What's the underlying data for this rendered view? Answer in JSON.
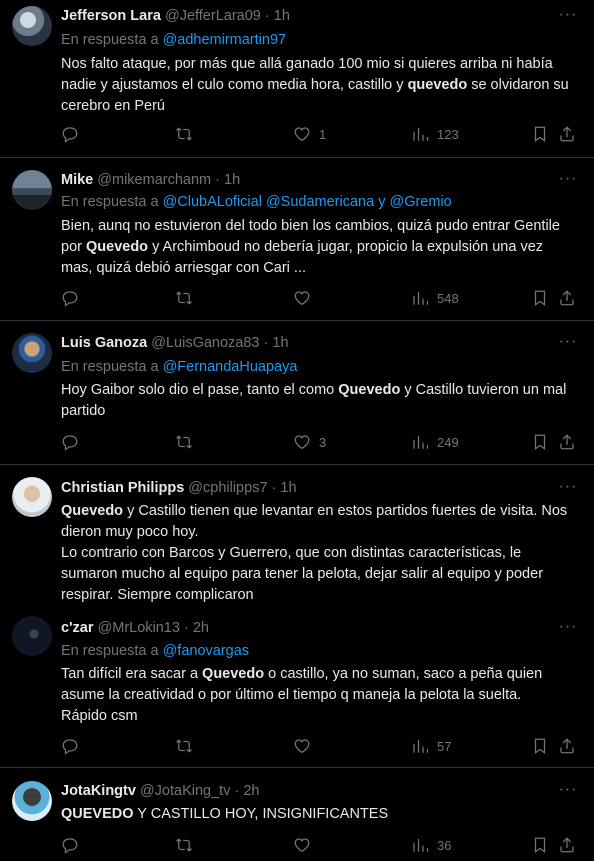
{
  "tweets": [
    {
      "name": "Jefferson Lara",
      "handle": "@JefferLara09",
      "sep": "·",
      "time": "1h",
      "reply_prefix": "En respuesta a",
      "reply_to": "@adhemirmartin97",
      "body_1": "Nos falto ataque, por más que allá ganado 100 mio si quieres arriba ni había nadie y ajustamos el culo como media hora,  castillo y ",
      "body_2": "quevedo",
      "body_3": " se olvidaron su cerebro en Perú",
      "likes": "1",
      "views": "123"
    },
    {
      "name": "Mike",
      "handle": "@mikemarchanm",
      "sep": "·",
      "time": "1h",
      "reply_prefix": "En respuesta a",
      "reply_to": "@ClubALoficial @Sudamericana y @Gremio",
      "body_1": "Bien, aunq no estuvieron del todo bien los cambios, quizá pudo entrar Gentile por ",
      "body_2": "Quevedo",
      "body_3": " y Archimboud no debería jugar, propicio la expulsión una vez mas, quizá debió arriesgar con Cari ...",
      "likes": "",
      "views": "548"
    },
    {
      "name": "Luis Ganoza",
      "handle": "@LuisGanoza83",
      "sep": "·",
      "time": "1h",
      "reply_prefix": "En respuesta a",
      "reply_to": "@FernandaHuapaya",
      "body_1": "Hoy Gaibor solo dio el pase, tanto el como ",
      "body_2": "Quevedo",
      "body_3": " y Castillo tuvieron un mal partido",
      "likes": "3",
      "views": "249"
    },
    {
      "name": "Christian Philipps",
      "handle": "@cphilipps7",
      "sep": "·",
      "time": "1h",
      "body_1": "Quevedo",
      "body_2": " y Castillo tienen que levantar en estos partidos fuertes de visita. Nos dieron muy poco hoy.",
      "body_3": "Lo contrario con Barcos y Guerrero, que con distintas características, le sumaron mucho al equipo para tener la pelota, dejar salir al equipo y poder respirar. Siempre complicaron"
    },
    {
      "name": "c'zar",
      "handle": "@MrLokin13",
      "sep": "·",
      "time": "2h",
      "reply_prefix": "En respuesta a",
      "reply_to": "@fanovargas",
      "body_1": "Tan difícil era sacar a ",
      "body_2": "Quevedo",
      "body_3": " o castillo, ya no suman, saco a peña quien asume la creatividad o por último el tiempo q maneja la pelota la suelta. Rápido csm",
      "likes": "",
      "views": "57"
    },
    {
      "name": "JotaKingtv",
      "handle": "@JotaKing_tv",
      "sep": "·",
      "time": "2h",
      "body_1": "QUEVEDO",
      "body_2": " Y CASTILLO HOY, INSIGNIFICANTES",
      "likes": "",
      "views": "36"
    }
  ],
  "icons": {
    "reply": "reply-icon",
    "retweet": "retweet-icon",
    "like": "heart-icon",
    "views": "views-chart-icon",
    "bookmark": "bookmark-icon",
    "share": "share-icon",
    "more": "more-dots-icon"
  },
  "colors": {
    "background": "#000000",
    "text": "#e7e9ea",
    "muted": "#71767b",
    "link": "#1d9bf0",
    "divider": "#2f3336"
  }
}
